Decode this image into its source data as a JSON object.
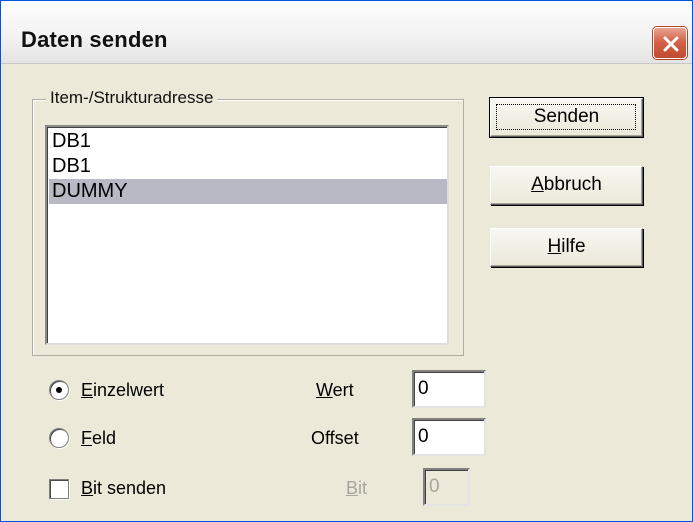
{
  "window": {
    "title": "Daten senden"
  },
  "group": {
    "label": "Item-/Strukturadresse",
    "items": [
      "DB1",
      "DB1",
      "DUMMY"
    ],
    "selected_index": 2
  },
  "buttons": {
    "send": {
      "label": "Senden"
    },
    "cancel": {
      "label_first": "A",
      "label_rest": "bbruch"
    },
    "help": {
      "label_first": "H",
      "label_rest": "ilfe"
    }
  },
  "options": {
    "single": {
      "label_first": "E",
      "label_rest": "inzelwert",
      "checked": true
    },
    "field": {
      "label_first": "F",
      "label_rest": "eld",
      "checked": false
    },
    "bit_send": {
      "label_first": "B",
      "label_rest": "it senden",
      "checked": false
    }
  },
  "inputs": {
    "value": {
      "label_first": "W",
      "label_rest": "ert",
      "value": "0"
    },
    "offset": {
      "label": "Offset",
      "value": "0"
    },
    "bit": {
      "label_first": "B",
      "label_rest": "it",
      "value": "0",
      "disabled": true
    }
  },
  "colors": {
    "selection": "#b9b9c6",
    "dialog_bg": "#ece9d8",
    "close_button": "#d5634a"
  }
}
